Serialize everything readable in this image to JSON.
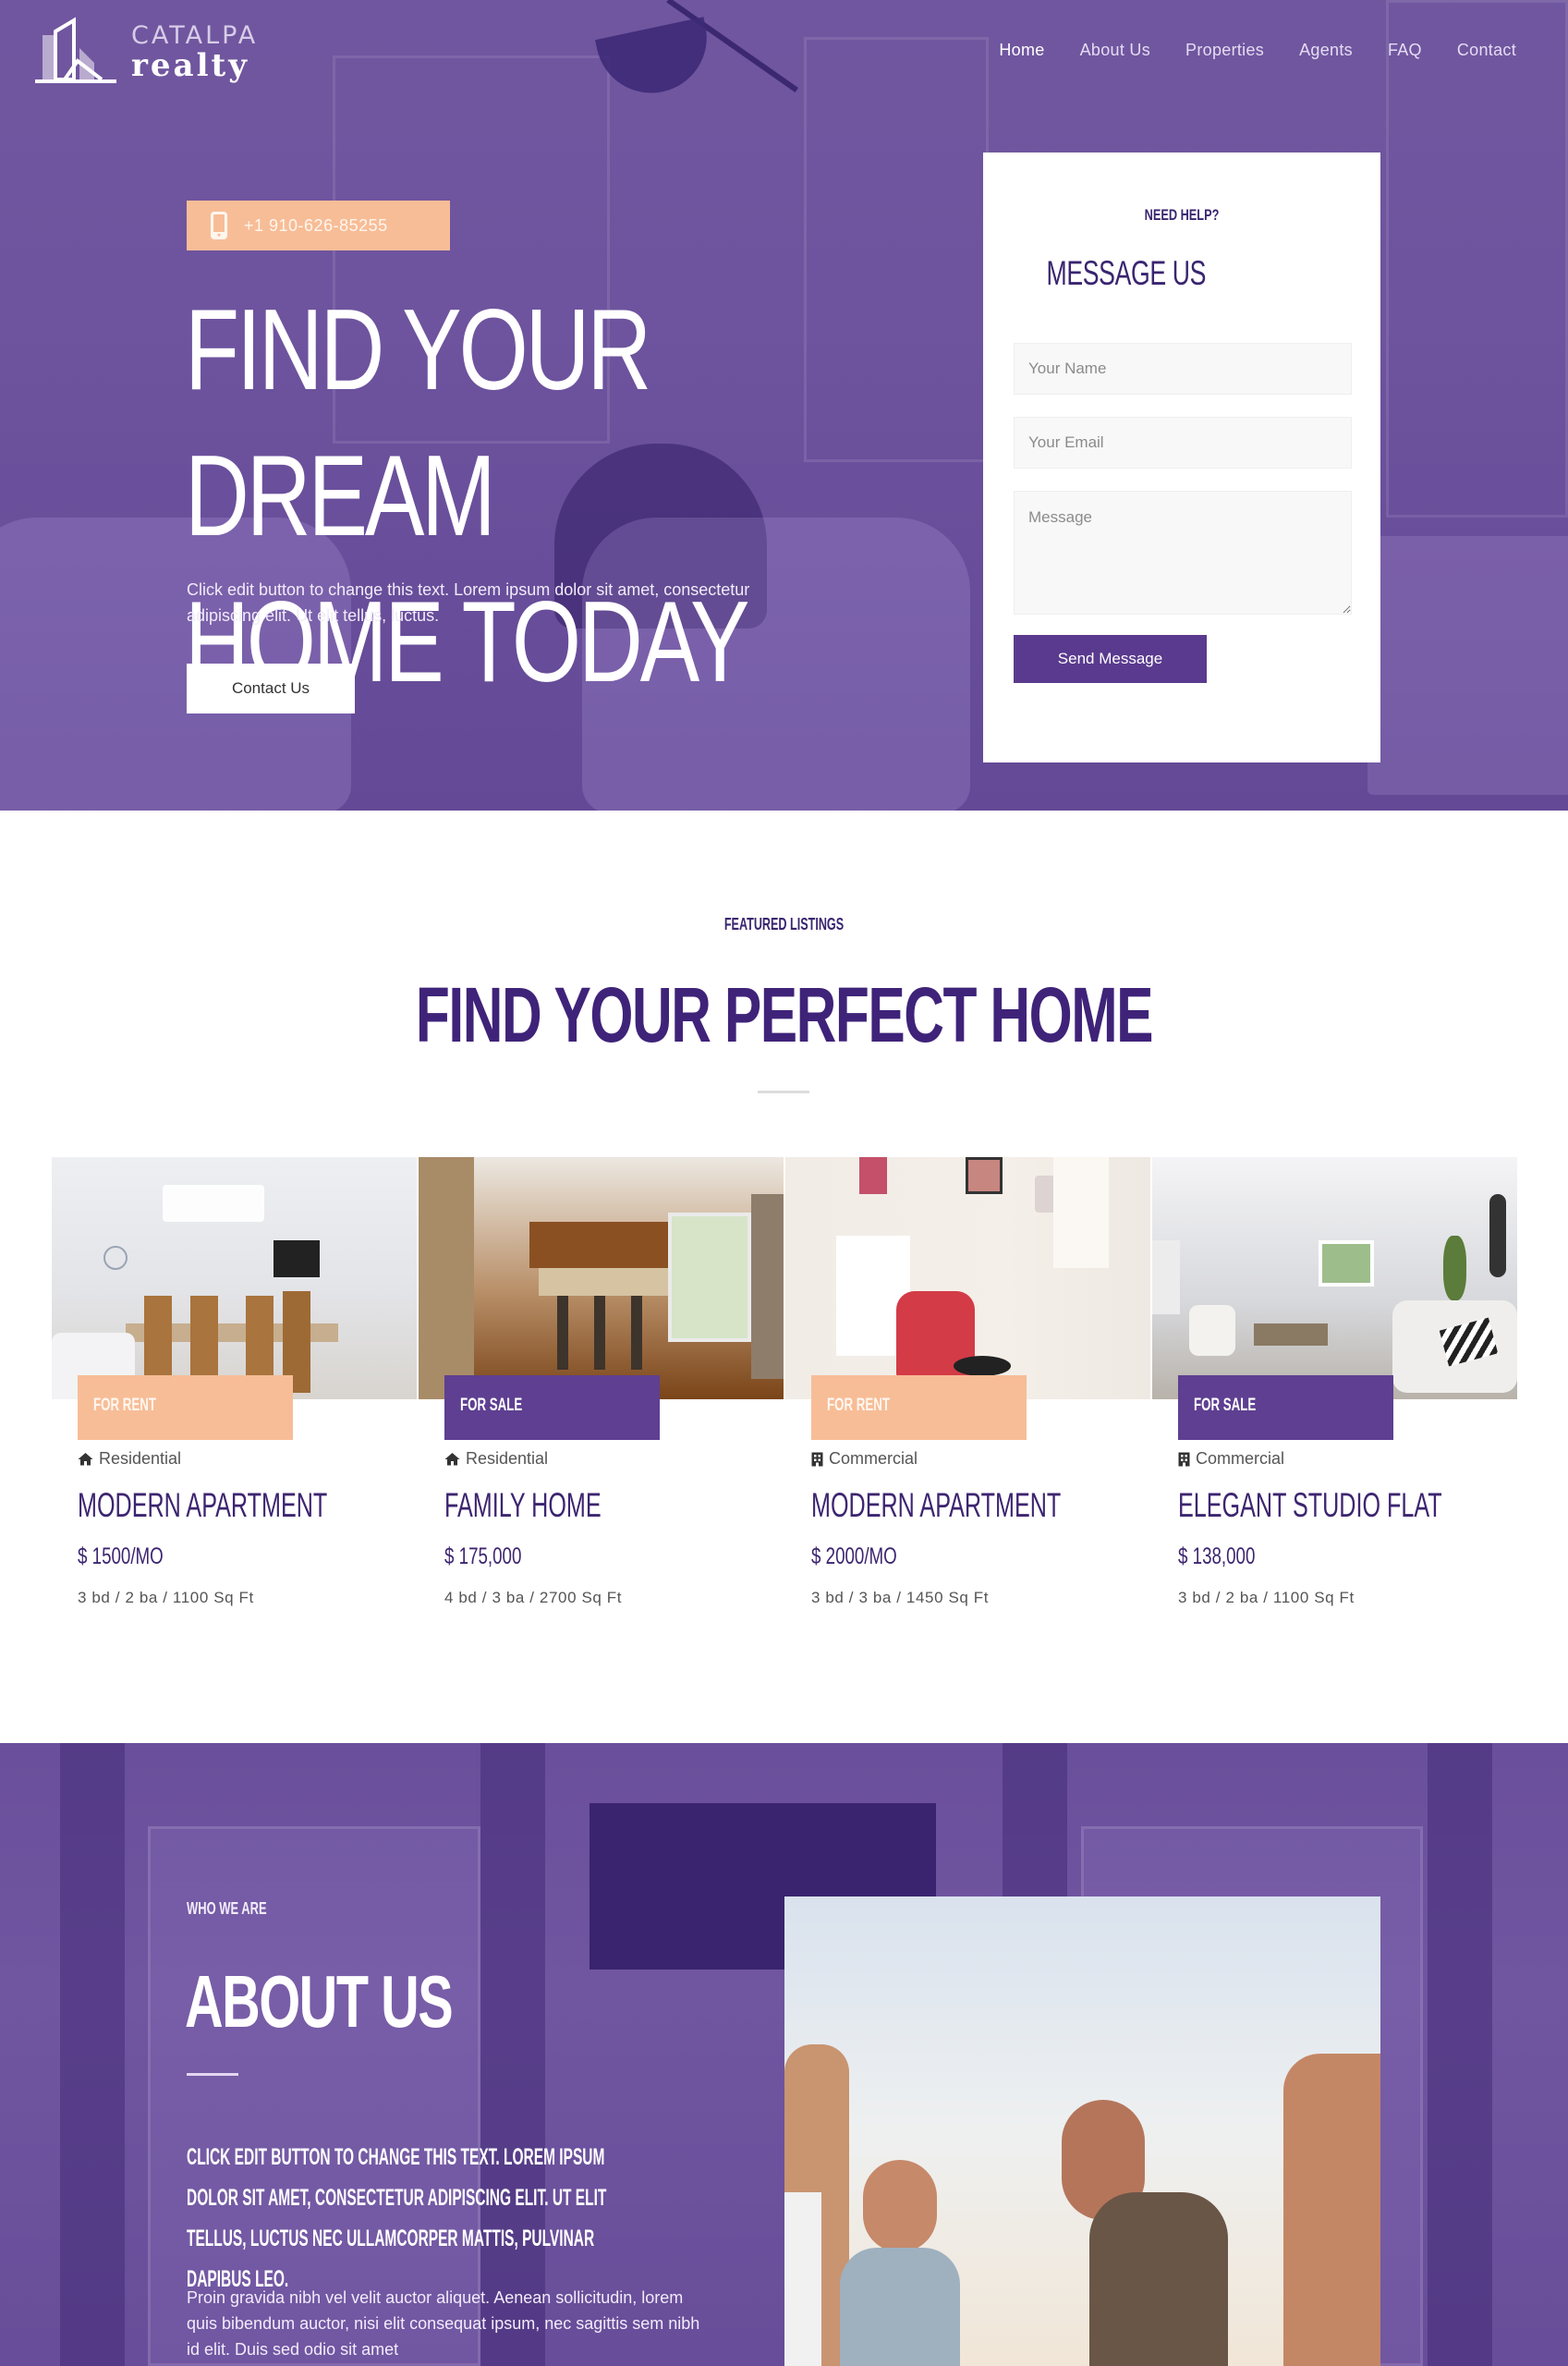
{
  "header": {
    "logo": {
      "top": "CATALPA",
      "bottom": "realty",
      "icon": "building-logo-icon"
    },
    "nav": [
      {
        "label": "Home",
        "active": true
      },
      {
        "label": "About Us",
        "active": false
      },
      {
        "label": "Properties",
        "active": false
      },
      {
        "label": "Agents",
        "active": false
      },
      {
        "label": "FAQ",
        "active": false
      },
      {
        "label": "Contact",
        "active": false
      }
    ]
  },
  "hero": {
    "phone": {
      "icon": "mobile-phone-icon",
      "number": "+1 910-626-85255"
    },
    "title_line1": "FIND YOUR DREAM",
    "title_line2": "HOME TODAY",
    "description": "Click edit button to change this text. Lorem ipsum dolor sit amet, consectetur adipiscing elit. Ut elit tellus, luctus.",
    "cta_label": "Contact Us"
  },
  "contact_form": {
    "kicker": "NEED HELP?",
    "title": "MESSAGE US",
    "name_placeholder": "Your Name",
    "email_placeholder": "Your Email",
    "message_placeholder": "Message",
    "submit_label": "Send Message"
  },
  "listings": {
    "kicker": "FEATURED LISTINGS",
    "title": "FIND YOUR PERFECT HOME",
    "items": [
      {
        "badge": "FOR RENT",
        "badge_type": "rent",
        "category": "Residential",
        "category_icon": "home-icon",
        "title": "MODERN APARTMENT",
        "price": "$ 1500/MO",
        "specs": "3 bd / 2 ba / 1100 Sq Ft"
      },
      {
        "badge": "FOR SALE",
        "badge_type": "sale",
        "category": "Residential",
        "category_icon": "home-icon",
        "title": "FAMILY HOME",
        "price": "$ 175,000",
        "specs": "4 bd / 3 ba / 2700 Sq Ft"
      },
      {
        "badge": "FOR RENT",
        "badge_type": "rent",
        "category": "Commercial",
        "category_icon": "building-icon",
        "title": "MODERN APARTMENT",
        "price": "$ 2000/MO",
        "specs": "3 bd / 3 ba / 1450 Sq Ft"
      },
      {
        "badge": "FOR SALE",
        "badge_type": "sale",
        "category": "Commercial",
        "category_icon": "building-icon",
        "title": "ELEGANT STUDIO FLAT",
        "price": "$ 138,000",
        "specs": "3 bd / 2 ba / 1100 Sq Ft"
      }
    ]
  },
  "about": {
    "kicker": "WHO WE ARE",
    "title": "ABOUT US",
    "lead": "CLICK EDIT BUTTON TO CHANGE THIS TEXT. LOREM IPSUM DOLOR SIT AMET, CONSECTETUR ADIPISCING ELIT. UT ELIT TELLUS, LUCTUS NEC ULLAMCORPER MATTIS, PULVINAR DAPIBUS LEO.",
    "body": "Proin gravida nibh vel velit auctor aliquet. Aenean sollicitudin, lorem quis bibendum auctor, nisi elit consequat ipsum, nec sagittis sem nibh id elit. Duis sed odio sit amet"
  },
  "colors": {
    "brand_purple": "#5a3a8e",
    "heading_purple": "#3f2379",
    "accent_peach": "#f7bd97",
    "overlay_purple": "#6246a0"
  }
}
